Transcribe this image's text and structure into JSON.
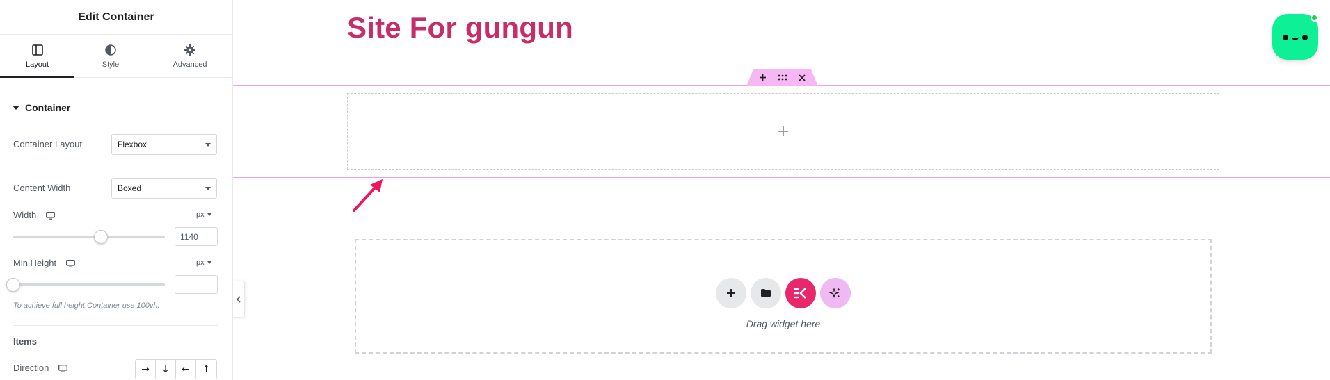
{
  "panel": {
    "title": "Edit Container",
    "tabs": [
      {
        "label": "Layout",
        "icon": "layout-icon",
        "active": true
      },
      {
        "label": "Style",
        "icon": "contrast-icon",
        "active": false
      },
      {
        "label": "Advanced",
        "icon": "gear-icon",
        "active": false
      }
    ],
    "section_title": "Container",
    "container_layout": {
      "label": "Container Layout",
      "value": "Flexbox"
    },
    "content_width": {
      "label": "Content Width",
      "value": "Boxed"
    },
    "width": {
      "label": "Width",
      "unit": "px",
      "value": "1140",
      "slider_fraction": 0.58
    },
    "min_height": {
      "label": "Min Height",
      "unit": "px",
      "value": "",
      "slider_fraction": 0.0
    },
    "hint": "To achieve full height Container use 100vh.",
    "items_title": "Items",
    "direction": {
      "label": "Direction",
      "options": [
        "→",
        "↓",
        "←",
        "↑"
      ]
    }
  },
  "canvas": {
    "site_title": "Site For gungun",
    "drop_text": "Drag widget here",
    "colors": {
      "site_title": "#c72e68",
      "selection": "#ef9ff0",
      "elementor_pink": "#e8286a",
      "ai_button": "#f1b9f3",
      "bot": "#0df095"
    }
  }
}
